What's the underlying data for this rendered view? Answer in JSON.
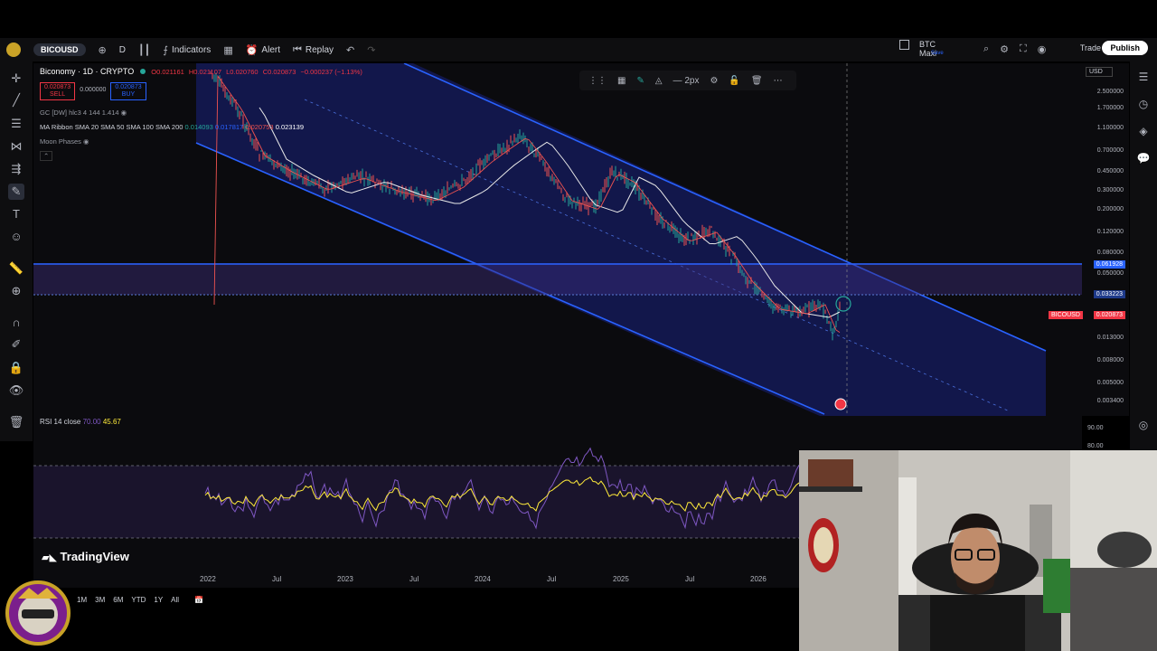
{
  "topbar": {
    "symbol": "BICOUSD",
    "interval": "D",
    "indicators_label": "Indicators",
    "alert_label": "Alert",
    "replay_label": "Replay",
    "layout_name": "BTC Maxi",
    "layout_sub": "Save",
    "trade_label": "Trade",
    "publish_label": "Publish"
  },
  "legend": {
    "title": "Biconomy · 1D · CRYPTO",
    "open": "O0.021161",
    "high": "H0.021107",
    "low": "L0.020760",
    "close": "C0.020873",
    "change": "−0.000237 (−1.13%)",
    "sell_price": "0.020873",
    "sell_label": "SELL",
    "spread": "0.000000",
    "buy_price": "0.020873",
    "buy_label": "BUY",
    "ind1": "GC [DW] hlc3 4 144 1.414",
    "ind2_name": "MA Ribbon SMA 20 SMA 50 SMA 100 SMA 200",
    "ind2_v1": "0.014093",
    "ind2_v2": "0.017817",
    "ind2_v3": "0.020753",
    "ind2_v4": "0.023139",
    "ind3": "Moon Phases"
  },
  "price_axis": {
    "currency": "USD",
    "ticks": [
      "2.500000",
      "1.700000",
      "1.100000",
      "0.700000",
      "0.450000",
      "0.300000",
      "0.200000",
      "0.120000",
      "0.080000",
      "0.050000",
      "0.030000",
      "0.013000",
      "0.008000",
      "0.005000",
      "0.003400"
    ],
    "label_upper": "0.061928",
    "label_mid": "0.033223",
    "label_symbol": "BICOUSD",
    "label_last": "0.020873"
  },
  "rsi": {
    "label": "RSI 14 close",
    "level": "70.00",
    "value": "45.67",
    "tick_90": "90.00",
    "tick_80": "80.00"
  },
  "time_axis": {
    "labels": [
      "2022",
      "Jul",
      "2023",
      "Jul",
      "2024",
      "Jul",
      "2025",
      "Jul",
      "2026"
    ]
  },
  "bottombar": {
    "ranges": [
      "1M",
      "3M",
      "6M",
      "YTD",
      "1Y",
      "All"
    ]
  },
  "branding": {
    "logo": "TradingView"
  },
  "drawing_toolbar": {
    "width_label": "2px"
  },
  "colors": {
    "channel": "#2962ff",
    "channel_fill": "#1a237e",
    "up": "#26a69a",
    "down": "#ef5350",
    "ma_white": "#e8e8e8",
    "rsi_purple": "#7e57c2",
    "rsi_yellow": "#ffeb3b"
  }
}
